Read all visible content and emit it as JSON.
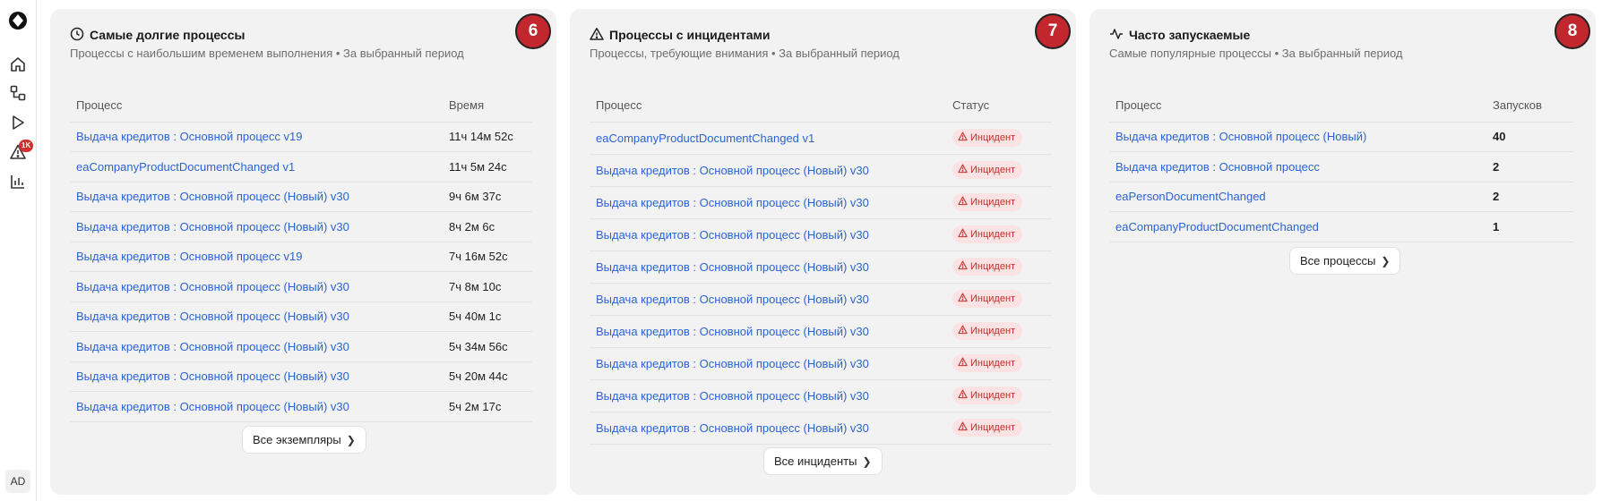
{
  "sidebar": {
    "alerts_badge": "1K",
    "avatar": "AD"
  },
  "cards": {
    "longest": {
      "number": "6",
      "title": "Самые долгие процессы",
      "subtitle": "Процессы с наибольшим временем выполнения • За выбранный период",
      "col_process": "Процесс",
      "col_time": "Время",
      "rows": [
        {
          "name": "Выдача кредитов : Основной процесс v19",
          "time": "11ч 14м 52с"
        },
        {
          "name": "eaCompanyProductDocumentChanged v1",
          "time": "11ч 5м 24с"
        },
        {
          "name": "Выдача кредитов : Основной процесс (Новый) v30",
          "time": "9ч 6м 37с"
        },
        {
          "name": "Выдача кредитов : Основной процесс (Новый) v30",
          "time": "8ч 2м 6с"
        },
        {
          "name": "Выдача кредитов : Основной процесс v19",
          "time": "7ч 16м 52с"
        },
        {
          "name": "Выдача кредитов : Основной процесс (Новый) v30",
          "time": "7ч 8м 10с"
        },
        {
          "name": "Выдача кредитов : Основной процесс (Новый) v30",
          "time": "5ч 40м 1с"
        },
        {
          "name": "Выдача кредитов : Основной процесс (Новый) v30",
          "time": "5ч 34м 56с"
        },
        {
          "name": "Выдача кредитов : Основной процесс (Новый) v30",
          "time": "5ч 20м 44с"
        },
        {
          "name": "Выдача кредитов : Основной процесс (Новый) v30",
          "time": "5ч 2м 17с"
        }
      ],
      "button": "Все экземпляры"
    },
    "incidents": {
      "number": "7",
      "title": "Процессы с инцидентами",
      "subtitle": "Процессы, требующие внимания • За выбранный период",
      "col_process": "Процесс",
      "col_status": "Статус",
      "rows": [
        {
          "name": "eaCompanyProductDocumentChanged v1",
          "status": "Инцидент"
        },
        {
          "name": "Выдача кредитов : Основной процесс (Новый) v30",
          "status": "Инцидент"
        },
        {
          "name": "Выдача кредитов : Основной процесс (Новый) v30",
          "status": "Инцидент"
        },
        {
          "name": "Выдача кредитов : Основной процесс (Новый) v30",
          "status": "Инцидент"
        },
        {
          "name": "Выдача кредитов : Основной процесс (Новый) v30",
          "status": "Инцидент"
        },
        {
          "name": "Выдача кредитов : Основной процесс (Новый) v30",
          "status": "Инцидент"
        },
        {
          "name": "Выдача кредитов : Основной процесс (Новый) v30",
          "status": "Инцидент"
        },
        {
          "name": "Выдача кредитов : Основной процесс (Новый) v30",
          "status": "Инцидент"
        },
        {
          "name": "Выдача кредитов : Основной процесс (Новый) v30",
          "status": "Инцидент"
        },
        {
          "name": "Выдача кредитов : Основной процесс (Новый) v30",
          "status": "Инцидент"
        }
      ],
      "button": "Все инциденты"
    },
    "frequent": {
      "number": "8",
      "title": "Часто запускаемые",
      "subtitle": "Самые популярные процессы • За выбранный период",
      "col_process": "Процесс",
      "col_runs": "Запусков",
      "rows": [
        {
          "name": "Выдача кредитов : Основной процесс (Новый)",
          "runs": "40"
        },
        {
          "name": "Выдача кредитов : Основной процесс",
          "runs": "2"
        },
        {
          "name": "eaPersonDocumentChanged",
          "runs": "2"
        },
        {
          "name": "eaCompanyProductDocumentChanged",
          "runs": "1"
        }
      ],
      "button": "Все процессы"
    }
  },
  "colors": {
    "link": "#2b64d4",
    "incident_bg": "#fbe3e3",
    "incident_text": "#c4302b",
    "number_badge": "#c1272d",
    "card_bg": "#f2f2f2"
  }
}
